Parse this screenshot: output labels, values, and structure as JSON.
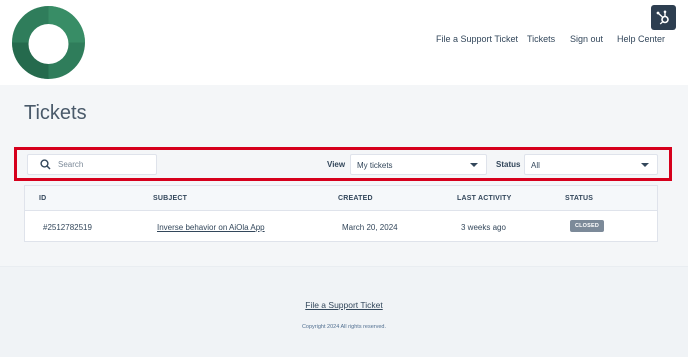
{
  "nav": {
    "items": [
      "File a Support Ticket",
      "Tickets",
      "Sign out",
      "Help Center"
    ]
  },
  "page": {
    "title": "Tickets"
  },
  "filters": {
    "search_placeholder": "Search",
    "view_label": "View",
    "view_value": "My tickets",
    "status_label": "Status",
    "status_value": "All"
  },
  "table": {
    "headers": [
      "ID",
      "SUBJECT",
      "CREATED",
      "LAST ACTIVITY",
      "STATUS"
    ],
    "rows": [
      {
        "id": "#2512782519",
        "subject": "Inverse behavior on AiOla App",
        "created": "March 20, 2024",
        "last_activity": "3 weeks ago",
        "status": "CLOSED"
      }
    ]
  },
  "footer": {
    "link": "File a Support Ticket",
    "copyright": "Copyright 2024 All rights reserved."
  },
  "colors": {
    "logo_green": "#2f7d5b",
    "highlight_border": "#d6001c",
    "badge_closed": "#7c8a99",
    "hub_button": "#2d3e50"
  },
  "icons": [
    "company-logo-icon",
    "hubspot-sprocket-icon",
    "search-icon",
    "chevron-down-icon"
  ]
}
